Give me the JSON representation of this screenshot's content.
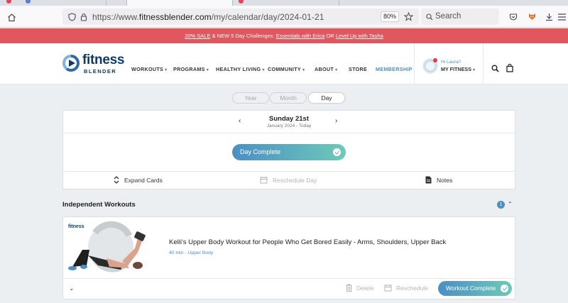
{
  "browser": {
    "url_prefix": "https://www.",
    "url_domain": "fitnessblender.com",
    "url_path": "/my/calendar/day/2024-01-21",
    "zoom": "80%",
    "search_placeholder": "Search"
  },
  "promo": {
    "sale": "20% SALE",
    "middle": " & NEW 5 Day Challenges: ",
    "challenge1": "Essentials with Erica",
    "or": " OR ",
    "challenge2": "Level Up with Tasha"
  },
  "brand": {
    "word1": "fitness",
    "word2": "BLENDER"
  },
  "nav": {
    "workouts": "WORKOUTS",
    "programs": "PROGRAMS",
    "healthy_living": "HEALTHY LIVING",
    "community": "COMMUNITY",
    "about": "ABOUT",
    "store": "STORE",
    "membership": "MEMBERSHIP"
  },
  "user": {
    "greeting": "Hi Laura!!",
    "menu": "MY FITNESS"
  },
  "view_tabs": {
    "year": "Year",
    "month": "Month",
    "day": "Day",
    "active": "Day"
  },
  "day": {
    "title": "Sunday 21st",
    "subtitle": "January 2024 - Today",
    "complete_label": "Day Complete",
    "expand": "Expand Cards",
    "reschedule": "Reschedule Day",
    "notes": "Notes"
  },
  "section": {
    "title": "Independent Workouts",
    "count": "1"
  },
  "workout": {
    "title": "Kelli's Upper Body Workout for People Who Get Bored Easily - Arms, Shoulders, Upper Back",
    "meta": "40 min - Upper Body",
    "delete": "Delete",
    "reschedule": "Reschedule",
    "complete_label": "Workout Complete",
    "thumb_brand": "fitness"
  },
  "colors": {
    "promo": "#e0575e",
    "accent": "#4b8fc4",
    "accent2": "#6fc9b9",
    "brand": "#0d3b66"
  }
}
